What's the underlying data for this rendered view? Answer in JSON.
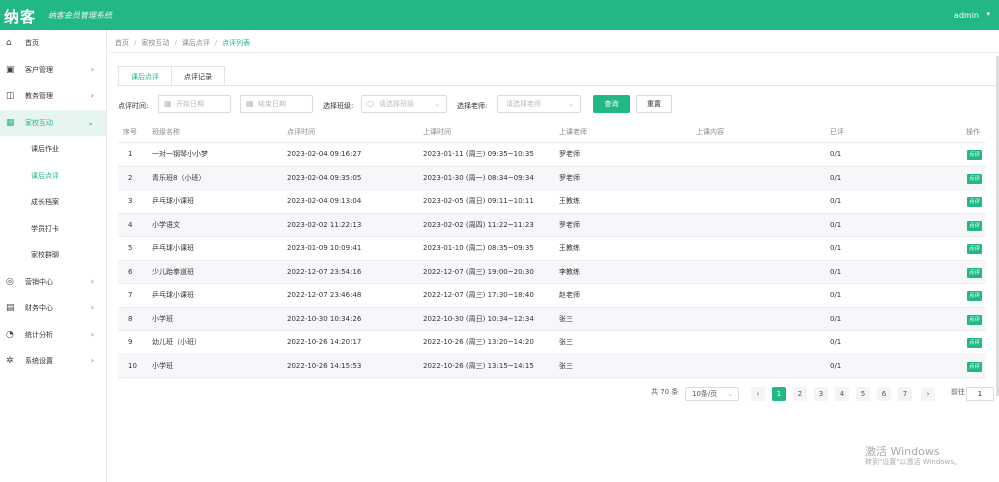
{
  "topbar": {
    "logo": "纳客",
    "slogan": "纳客会员管理系统",
    "user": "admin",
    "user_caret": "▾"
  },
  "sidebar": {
    "items": [
      {
        "icon": "home-icon",
        "glyph": "⌂",
        "label": "首页",
        "chev": ""
      },
      {
        "icon": "member-icon",
        "glyph": "▣",
        "label": "客户管理",
        "chev": "›"
      },
      {
        "icon": "book-icon",
        "glyph": "◫",
        "label": "教务管理",
        "chev": "›"
      },
      {
        "icon": "school-icon",
        "glyph": "▦",
        "label": "家校互动",
        "chev": "⌄",
        "open": true
      },
      {
        "icon": "gift-icon",
        "glyph": "◎",
        "label": "营销中心",
        "chev": "›"
      },
      {
        "icon": "finance-icon",
        "glyph": "▤",
        "label": "财务中心",
        "chev": "›"
      },
      {
        "icon": "chart-icon",
        "glyph": "◔",
        "label": "统计分析",
        "chev": "›"
      },
      {
        "icon": "gear-icon",
        "glyph": "✲",
        "label": "系统设置",
        "chev": "›"
      }
    ],
    "subitems": [
      {
        "label": "课后作业",
        "active": false
      },
      {
        "label": "课后点评",
        "active": true
      },
      {
        "label": "成长档案",
        "active": false
      },
      {
        "label": "学员打卡",
        "active": false
      },
      {
        "label": "家校群聊",
        "active": false
      }
    ]
  },
  "breadcrumb": [
    "首页",
    "家校互动",
    "课后点评",
    "点评列表"
  ],
  "tabs": [
    "课后点评",
    "点评记录"
  ],
  "filters": {
    "time_label": "点评时间:",
    "start_placeholder": "开始日期",
    "end_placeholder": "结束日期",
    "class_label": "选择班级:",
    "class_placeholder": "请选择班级",
    "teacher_label": "选择老师:",
    "teacher_placeholder": "请选择老师",
    "search": "查询",
    "reset": "重置"
  },
  "table": {
    "columns": [
      "序号",
      "班级名称",
      "点评时间",
      "上课时间",
      "上课老师",
      "上课内容",
      "已评",
      "操作"
    ],
    "rows": [
      {
        "idx": "1",
        "cls": "一对一钢琴小小梦",
        "rt": "2023-02-04 09:16:27",
        "ct": "2023-01-11 (周三) 09:35~10:35",
        "tea": "罗老师",
        "content": "",
        "done": "0/1",
        "act": "点评"
      },
      {
        "idx": "2",
        "cls": "青乐班8（小班）",
        "rt": "2023-02-04 09:35:05",
        "ct": "2023-01-30 (周一) 08:34~09:34",
        "tea": "罗老师",
        "content": "",
        "done": "0/1",
        "act": "点评"
      },
      {
        "idx": "3",
        "cls": "乒乓球小课班",
        "rt": "2023-02-04 09:13:04",
        "ct": "2023-02-05 (周日) 09:11~10:11",
        "tea": "王教练",
        "content": "",
        "done": "0/1",
        "act": "点评"
      },
      {
        "idx": "4",
        "cls": "小学语文",
        "rt": "2023-02-02 11:22:13",
        "ct": "2023-02-02 (周四) 11:22~11:23",
        "tea": "罗老师",
        "content": "",
        "done": "0/1",
        "act": "点评"
      },
      {
        "idx": "5",
        "cls": "乒乓球小课班",
        "rt": "2023-01-09 10:09:41",
        "ct": "2023-01-10 (周二) 08:35~09:35",
        "tea": "王教练",
        "content": "",
        "done": "0/1",
        "act": "点评"
      },
      {
        "idx": "6",
        "cls": "少儿跆拳道班",
        "rt": "2022-12-07 23:54:16",
        "ct": "2022-12-07 (周三) 19:00~20:30",
        "tea": "李教练",
        "content": "",
        "done": "0/1",
        "act": "点评"
      },
      {
        "idx": "7",
        "cls": "乒乓球小课班",
        "rt": "2022-12-07 23:46:48",
        "ct": "2022-12-07 (周三) 17:30~18:40",
        "tea": "赵老师",
        "content": "",
        "done": "0/1",
        "act": "点评"
      },
      {
        "idx": "8",
        "cls": "小学班",
        "rt": "2022-10-30 10:34:26",
        "ct": "2022-10-30 (周日) 10:34~12:34",
        "tea": "张三",
        "content": "",
        "done": "0/1",
        "act": "点评"
      },
      {
        "idx": "9",
        "cls": "幼儿班（小班）",
        "rt": "2022-10-26 14:20:17",
        "ct": "2022-10-26 (周三) 13:20~14:20",
        "tea": "张三",
        "content": "",
        "done": "0/1",
        "act": "点评"
      },
      {
        "idx": "10",
        "cls": "小学班",
        "rt": "2022-10-26 14:15:53",
        "ct": "2022-10-26 (周三) 13:15~14:15",
        "tea": "张三",
        "content": "",
        "done": "0/1",
        "act": "点评"
      }
    ]
  },
  "pagination": {
    "total": "共 70 条",
    "page_size": "10条/页",
    "prev": "‹",
    "next": "›",
    "pages": [
      "1",
      "2",
      "3",
      "4",
      "5",
      "6",
      "7"
    ],
    "current": "1",
    "goto_label": "前往",
    "goto_value": "1"
  },
  "watermark": {
    "line1": "激活 Windows",
    "line2": "转到\"设置\"以激活 Windows。"
  },
  "colors": {
    "accent": "#22b883"
  }
}
